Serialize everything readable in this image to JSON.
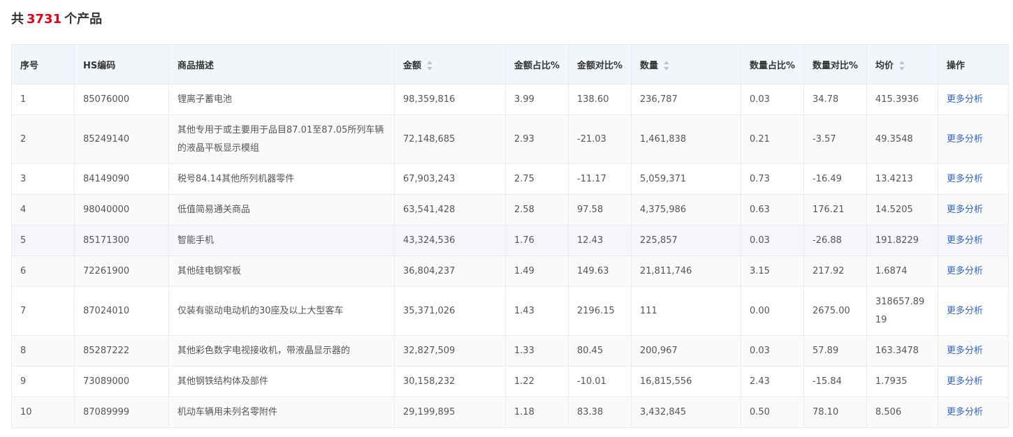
{
  "summary": {
    "prefix": "共",
    "count": "3731",
    "suffix": "个产品"
  },
  "table": {
    "columns": [
      {
        "key": "index",
        "label": "序号",
        "sortable": false
      },
      {
        "key": "hs_code",
        "label": "HS编码",
        "sortable": false
      },
      {
        "key": "description",
        "label": "商品描述",
        "sortable": false
      },
      {
        "key": "amount",
        "label": "金额",
        "sortable": true
      },
      {
        "key": "amount_share",
        "label": "金额占比%",
        "sortable": false
      },
      {
        "key": "amount_yoy",
        "label": "金额对比%",
        "sortable": false
      },
      {
        "key": "quantity",
        "label": "数量",
        "sortable": true
      },
      {
        "key": "quantity_share",
        "label": "数量占比%",
        "sortable": false
      },
      {
        "key": "quantity_yoy",
        "label": "数量对比%",
        "sortable": false
      },
      {
        "key": "avg_price",
        "label": "均价",
        "sortable": true
      },
      {
        "key": "action",
        "label": "操作",
        "sortable": false
      }
    ],
    "action_label": "更多分析",
    "rows": [
      {
        "index": "1",
        "hs_code": "85076000",
        "description": "锂离子蓄电池",
        "amount": "98,359,816",
        "amount_share": "3.99",
        "amount_yoy": "138.60",
        "quantity": "236,787",
        "quantity_share": "0.03",
        "quantity_yoy": "34.78",
        "avg_price": "415.3936"
      },
      {
        "index": "2",
        "hs_code": "85249140",
        "description": "其他专用于或主要用于品目87.01至87.05所列车辆的液晶平板显示模组",
        "amount": "72,148,685",
        "amount_share": "2.93",
        "amount_yoy": "-21.03",
        "quantity": "1,461,838",
        "quantity_share": "0.21",
        "quantity_yoy": "-3.57",
        "avg_price": "49.3548"
      },
      {
        "index": "3",
        "hs_code": "84149090",
        "description": "税号84.14其他所列机器零件",
        "amount": "67,903,243",
        "amount_share": "2.75",
        "amount_yoy": "-11.17",
        "quantity": "5,059,371",
        "quantity_share": "0.73",
        "quantity_yoy": "-16.49",
        "avg_price": "13.4213"
      },
      {
        "index": "4",
        "hs_code": "98040000",
        "description": "低值简易通关商品",
        "amount": "63,541,428",
        "amount_share": "2.58",
        "amount_yoy": "97.58",
        "quantity": "4,375,986",
        "quantity_share": "0.63",
        "quantity_yoy": "176.21",
        "avg_price": "14.5205"
      },
      {
        "index": "5",
        "hs_code": "85171300",
        "description": "智能手机",
        "amount": "43,324,536",
        "amount_share": "1.76",
        "amount_yoy": "12.43",
        "quantity": "225,857",
        "quantity_share": "0.03",
        "quantity_yoy": "-26.88",
        "avg_price": "191.8229"
      },
      {
        "index": "6",
        "hs_code": "72261900",
        "description": "其他硅电钢窄板",
        "amount": "36,804,237",
        "amount_share": "1.49",
        "amount_yoy": "149.63",
        "quantity": "21,811,746",
        "quantity_share": "3.15",
        "quantity_yoy": "217.92",
        "avg_price": "1.6874"
      },
      {
        "index": "7",
        "hs_code": "87024010",
        "description": "仅装有驱动电动机的30座及以上大型客车",
        "amount": "35,371,026",
        "amount_share": "1.43",
        "amount_yoy": "2196.15",
        "quantity": "111",
        "quantity_share": "0.00",
        "quantity_yoy": "2675.00",
        "avg_price": "318657.8919"
      },
      {
        "index": "8",
        "hs_code": "85287222",
        "description": "其他彩色数字电视接收机，带液晶显示器的",
        "amount": "32,827,509",
        "amount_share": "1.33",
        "amount_yoy": "80.45",
        "quantity": "200,967",
        "quantity_share": "0.03",
        "quantity_yoy": "57.89",
        "avg_price": "163.3478"
      },
      {
        "index": "9",
        "hs_code": "73089000",
        "description": "其他钢铁结构体及部件",
        "amount": "30,158,232",
        "amount_share": "1.22",
        "amount_yoy": "-10.01",
        "quantity": "16,815,556",
        "quantity_share": "2.43",
        "quantity_yoy": "-15.84",
        "avg_price": "1.7935"
      },
      {
        "index": "10",
        "hs_code": "87089999",
        "description": "机动车辆用未列名零附件",
        "amount": "29,199,895",
        "amount_share": "1.18",
        "amount_yoy": "83.38",
        "quantity": "3,432,845",
        "quantity_share": "0.50",
        "quantity_yoy": "78.10",
        "avg_price": "8.506"
      }
    ]
  }
}
